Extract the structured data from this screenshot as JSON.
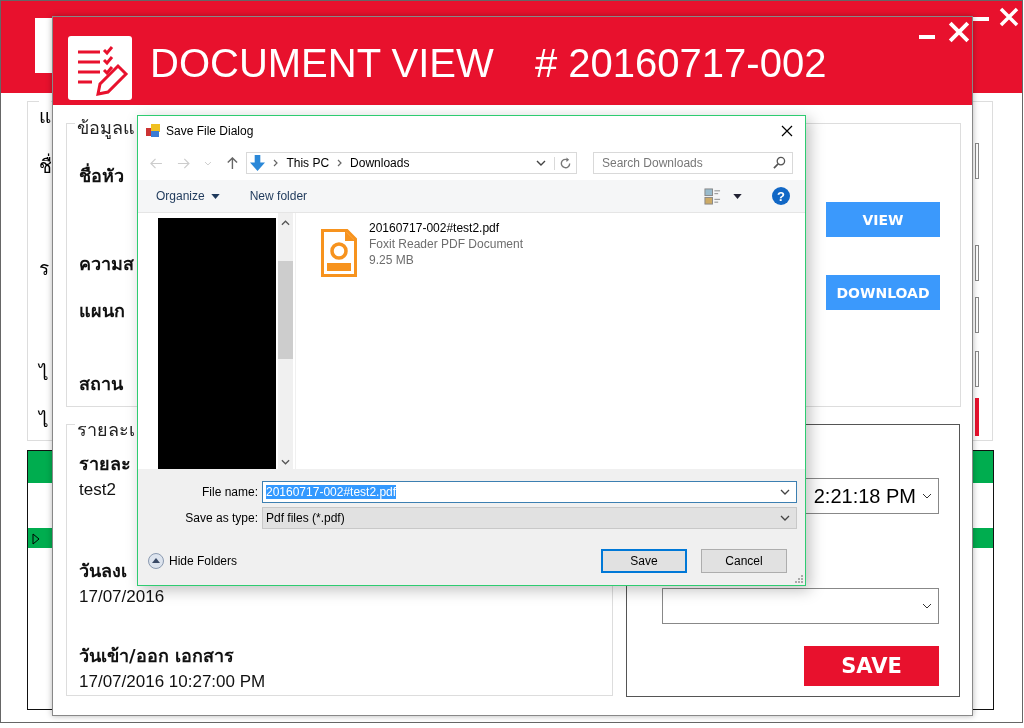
{
  "background_window": {
    "labels": [
      "แ",
      "ชื่",
      "ร",
      "ไ",
      "ไ"
    ]
  },
  "main_window": {
    "title": "DOCUMENT VIEW",
    "number": "# 20160717-002",
    "info_group": {
      "legend": "ข้อมูลแ",
      "labels": [
        "ชื่อหัว",
        "ความส",
        "แผนก",
        "สถาน"
      ]
    },
    "buttons": [
      {
        "label": "VIEW"
      },
      {
        "label": "DOWNLOAD"
      }
    ],
    "details_group": {
      "legend": "รายละเ",
      "fields": [
        {
          "label": "รายละ",
          "value": "test2"
        },
        {
          "label": "วันลงเ",
          "value": "17/07/2016"
        },
        {
          "label": "วันเข้า/ออก เอกสาร",
          "value": "17/07/2016 10:27:00 PM"
        }
      ]
    },
    "time_picker": {
      "value": "2:21:18 PM"
    },
    "save_button": "SAVE"
  },
  "dialog": {
    "title": "Save File Dialog",
    "path": [
      "This PC",
      "Downloads"
    ],
    "search_placeholder": "Search Downloads",
    "toolbar": [
      "Organize",
      "New folder"
    ],
    "files": [
      {
        "name": "20160717-002#test2.pdf",
        "type": "Foxit Reader PDF Document",
        "size": "9.25 MB"
      }
    ],
    "file_name": {
      "label": "File name:",
      "value": "20160717-002#test2.pdf",
      "selected": true
    },
    "save_as_type": {
      "label": "Save as type:",
      "value": "Pdf files (*.pdf)"
    },
    "hide_folders": "Hide Folders",
    "help": "?",
    "buttons": [
      {
        "label": "Save",
        "default": true
      },
      {
        "label": "Cancel",
        "default": false
      }
    ]
  }
}
